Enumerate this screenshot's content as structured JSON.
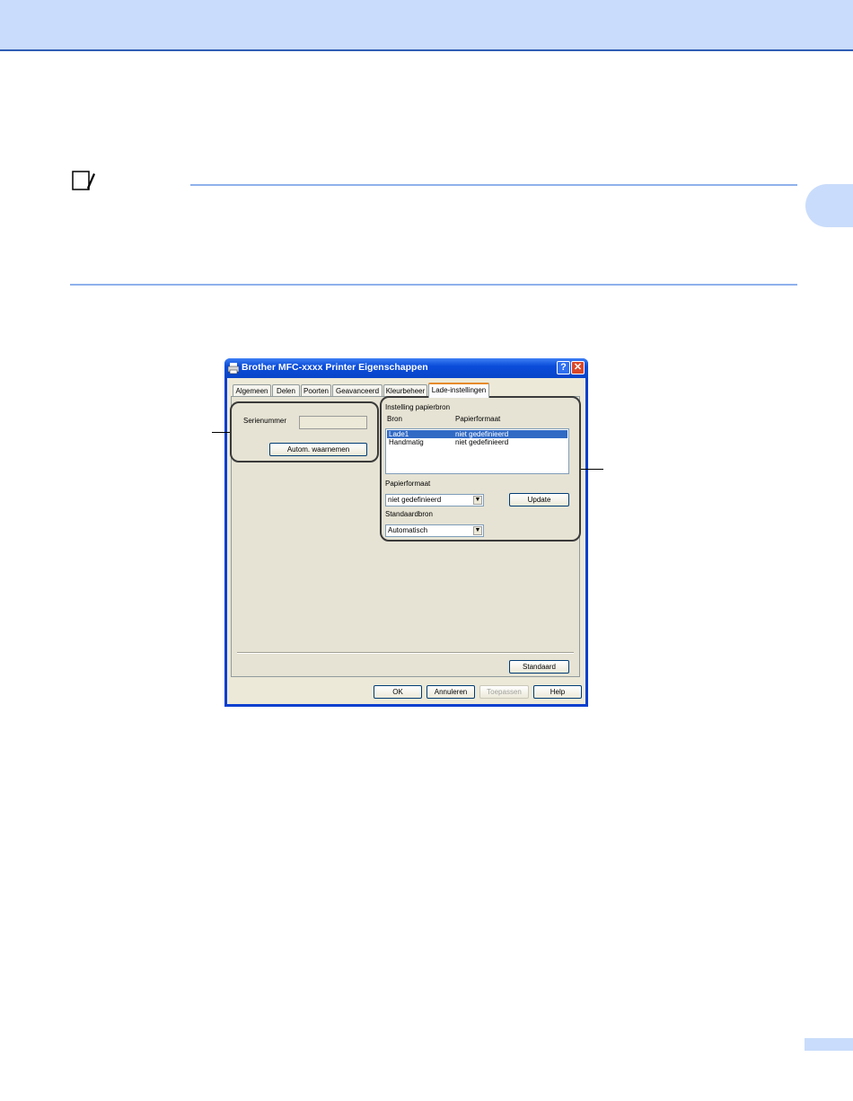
{
  "dialog": {
    "title": "Brother MFC-xxxx Printer Eigenschappen",
    "help_glyph": "?",
    "close_glyph": "✕",
    "tabs": [
      {
        "label": "Algemeen"
      },
      {
        "label": "Delen"
      },
      {
        "label": "Poorten"
      },
      {
        "label": "Geavanceerd"
      },
      {
        "label": "Kleurbeheer"
      },
      {
        "label": "Lade-instellingen",
        "active": true
      }
    ],
    "serial": {
      "label": "Serienummer",
      "value": "",
      "autodetect_button": "Autom. waarnemen"
    },
    "source": {
      "group_title": "Instelling papierbron",
      "col_source": "Bron",
      "col_size": "Papierformaat",
      "rows": [
        {
          "source": "Lade1",
          "size": "niet gedefinieerd",
          "selected": true
        },
        {
          "source": "Handmatig",
          "size": "niet gedefinieerd",
          "selected": false
        }
      ],
      "paper_size_label": "Papierformaat",
      "paper_size_value": "niet gedefinieerd",
      "update_button": "Update",
      "default_source_label": "Standaardbron",
      "default_source_value": "Automatisch"
    },
    "standard_button": "Standaard",
    "ok_button": "OK",
    "cancel_button": "Annuleren",
    "apply_button": "Toepassen",
    "help_button": "Help",
    "combo_arrow": "▼"
  },
  "colors": {
    "header_band": "#c9dcfb",
    "rule": "#8fb1ec",
    "titlebar": "#0a4cd9",
    "selection": "#316ac5"
  },
  "icons": {
    "note": "note-pencil-icon",
    "printer": "printer-icon"
  }
}
